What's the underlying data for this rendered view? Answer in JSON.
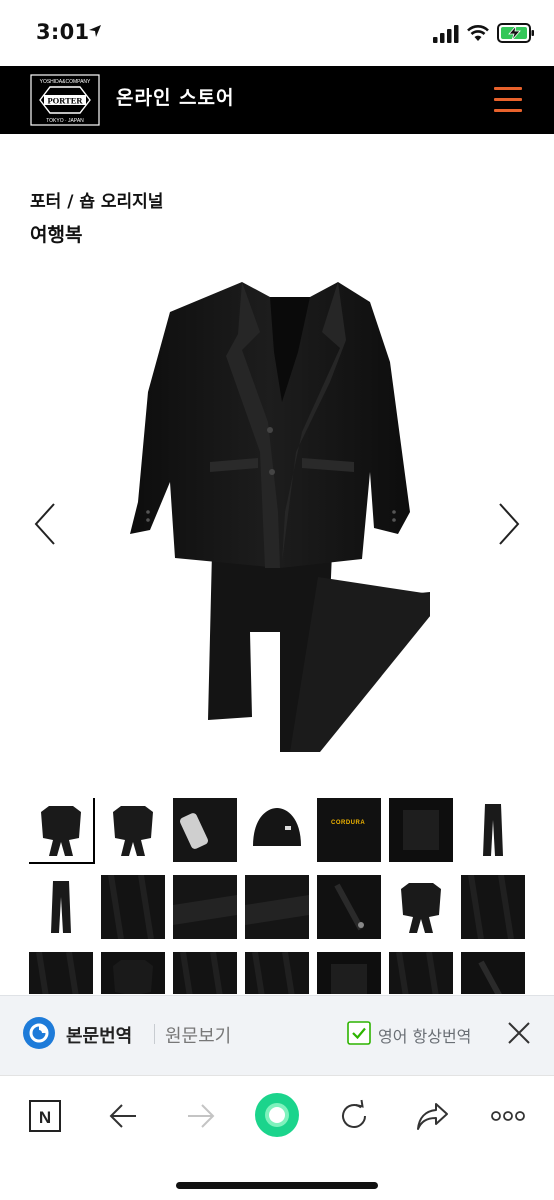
{
  "status_bar": {
    "time": "3:01"
  },
  "header": {
    "logo_text": "PORTER",
    "logo_top": "YOSHIDA & COMPANY",
    "logo_bottom": "TOKYO · JAPAN",
    "store_title": "온라인 스토어",
    "menu_icon": "hamburger-menu-icon"
  },
  "product": {
    "breadcrumb": "포터 / 숍 오리지널",
    "title": "여행복"
  },
  "thumbnails": [
    "suit-full",
    "suit-side",
    "fabric-detail",
    "jacket-back",
    "cordura-label",
    "label-detail",
    "trousers-front",
    "trousers-slim",
    "trousers-waist",
    "pocket-detail",
    "strap-detail",
    "pocket-zip",
    "jacket-front",
    "trousers-hem",
    "sleeve-detail",
    "jacket-fold",
    "fabric-dark",
    "collar-detail",
    "inner-detail",
    "pocket-flap",
    "button-detail"
  ],
  "cordura_text": "CORDURA",
  "translate_bar": {
    "translate_label": "본문번역",
    "original_label": "원문보기",
    "always_label": "영어 항상번역",
    "always_checked": true
  },
  "colors": {
    "accent_orange": "#e8622c",
    "papago_blue": "#1e7bd9",
    "check_green": "#2db400",
    "nav_green": "#1bd48c"
  }
}
